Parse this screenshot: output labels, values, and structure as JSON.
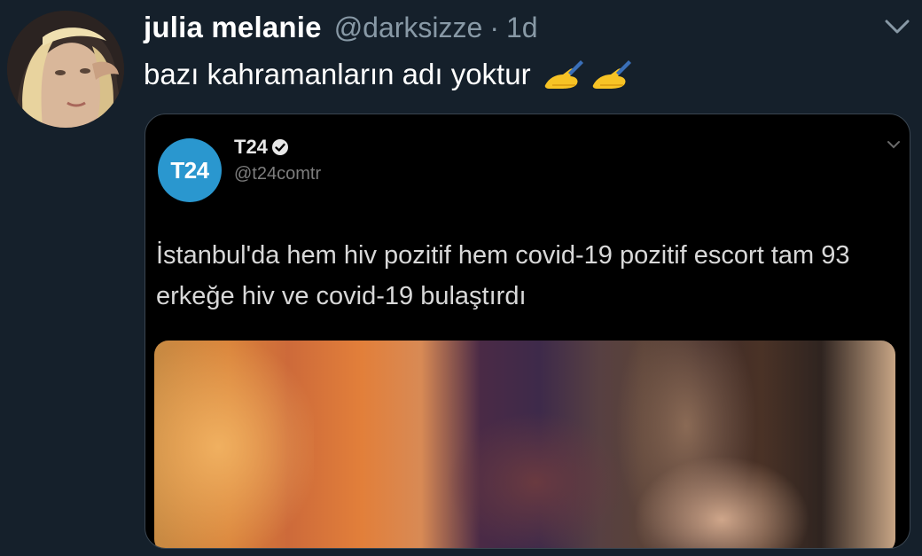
{
  "tweet": {
    "display_name": "julia melanie",
    "handle": "@darksizze",
    "separator": "·",
    "time": "1d",
    "text": "bazı kahramanların adı yoktur",
    "emojis": [
      "writing-hand-emoji",
      "writing-hand-emoji"
    ],
    "avatar_icon": "user-avatar-photo",
    "menu_icon": "chevron-down-icon"
  },
  "quoted": {
    "logo_text": "T24",
    "name": "T24",
    "verified_icon": "verified-badge-icon",
    "handle": "@t24comtr",
    "text": "İstanbul'da hem hiv pozitif hem covid-19 pozitif escort tam 93 erkeğe hiv ve covid-19 bulaştırdı",
    "menu_icon": "chevron-down-icon",
    "image_icon": "blurred-photo"
  },
  "colors": {
    "background": "#15202b",
    "secondary_text": "#8899a6",
    "t24_blue": "#2a97cf",
    "emoji_yellow": "#f7c325"
  }
}
